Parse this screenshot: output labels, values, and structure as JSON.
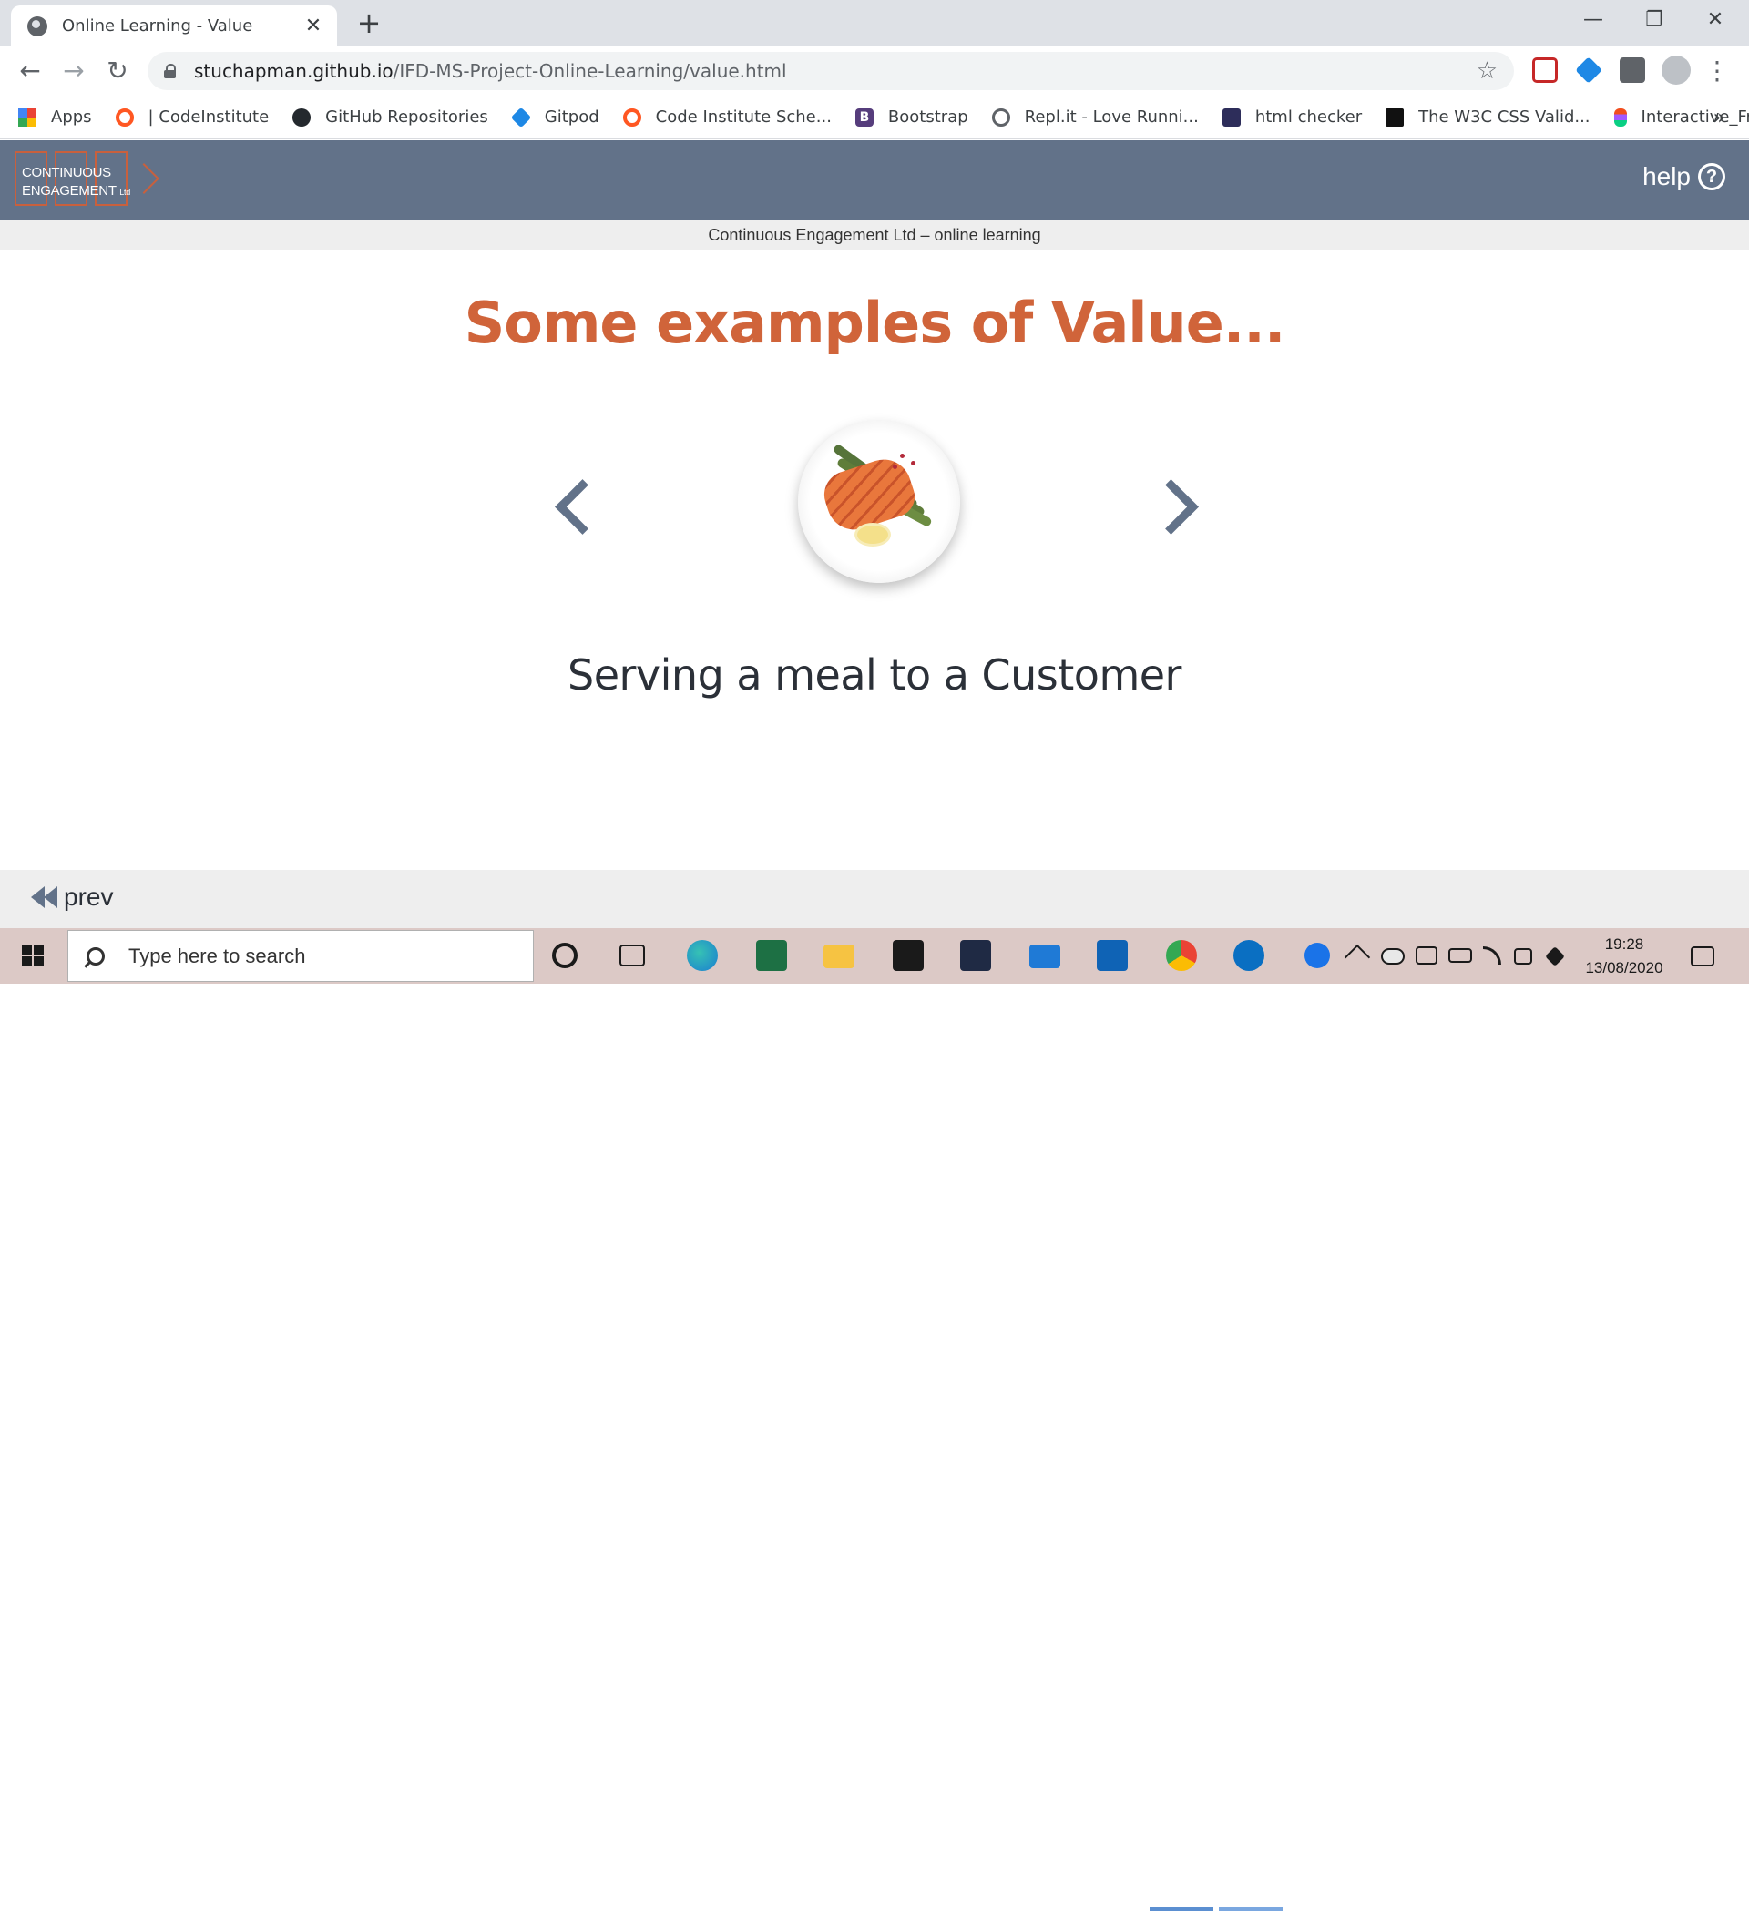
{
  "browser": {
    "tab_title": "Online Learning - Value",
    "tab_close": "✕",
    "new_tab": "+",
    "url_host": "stuchapman.github.io",
    "url_path": "/IFD-MS-Project-Online-Learning/value.html",
    "window_controls": {
      "minimize": "—",
      "restore": "❐",
      "close": "✕"
    },
    "bookmarks": [
      {
        "label": "Apps",
        "icon": "apps-grid-icon"
      },
      {
        "label": "| CodeInstitute",
        "icon": "codeinstitute-icon"
      },
      {
        "label": "GitHub Repositories",
        "icon": "github-icon"
      },
      {
        "label": "Gitpod",
        "icon": "gitpod-icon"
      },
      {
        "label": "Code Institute Sche...",
        "icon": "codeinstitute-icon"
      },
      {
        "label": "Bootstrap",
        "icon": "bootstrap-icon"
      },
      {
        "label": "Repl.it - Love Runni...",
        "icon": "replit-icon"
      },
      {
        "label": "html checker",
        "icon": "validator-icon"
      },
      {
        "label": "The W3C CSS Valid...",
        "icon": "w3c-icon"
      },
      {
        "label": "Interactive_Fronten...",
        "icon": "figma-icon"
      }
    ],
    "bookmarks_more": "»"
  },
  "site": {
    "logo_line1": "CONTINUOUS",
    "logo_line2": "ENGAGEMENT",
    "logo_ltd": "Ltd",
    "help_label": "help",
    "help_icon": "?",
    "subheader": "Continuous Engagement Ltd – online learning",
    "heading": "Some examples of Value...",
    "caption": "Serving a meal to a Customer",
    "prev_label": "prev",
    "accent_color": "#d0643a",
    "header_color": "#627289"
  },
  "taskbar": {
    "search_placeholder": "Type here to search",
    "time": "19:28",
    "date": "13/08/2020"
  }
}
